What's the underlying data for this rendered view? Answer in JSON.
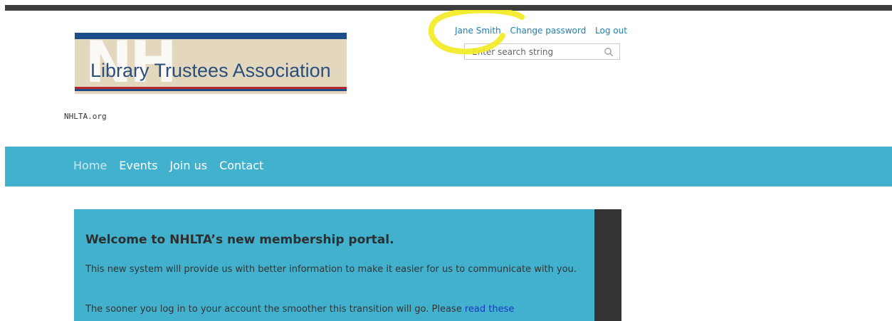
{
  "header": {
    "logo": {
      "watermark": "NH",
      "name": "Library Trustees Association"
    },
    "site_tag": "NHLTA.org",
    "user_links": {
      "user_name": "Jane Smith",
      "change_password": "Change password",
      "log_out": "Log out"
    },
    "search": {
      "placeholder": "Enter search string",
      "icon": "search-icon"
    }
  },
  "nav": {
    "items": [
      {
        "label": "Home",
        "active": true
      },
      {
        "label": "Events",
        "active": false
      },
      {
        "label": "Join us",
        "active": false
      },
      {
        "label": "Contact",
        "active": false
      }
    ]
  },
  "welcome": {
    "title": "Welcome to NHLTA’s new membership portal.",
    "p1": "This new system will provide us with better information to make it easier for us to communicate with you.",
    "p2_text": "The sooner you log in to your account the smoother this transition will go. Please ",
    "p2_link": "read these"
  },
  "colors": {
    "topbar": "#3d3d3d",
    "nav_bg": "#42b1ce",
    "link": "#1f7fb0",
    "annotation": "#f4ea1f",
    "logo_bg": "#e3d7bd",
    "logo_blue": "#1c4f8a",
    "logo_red": "#b8252d"
  }
}
